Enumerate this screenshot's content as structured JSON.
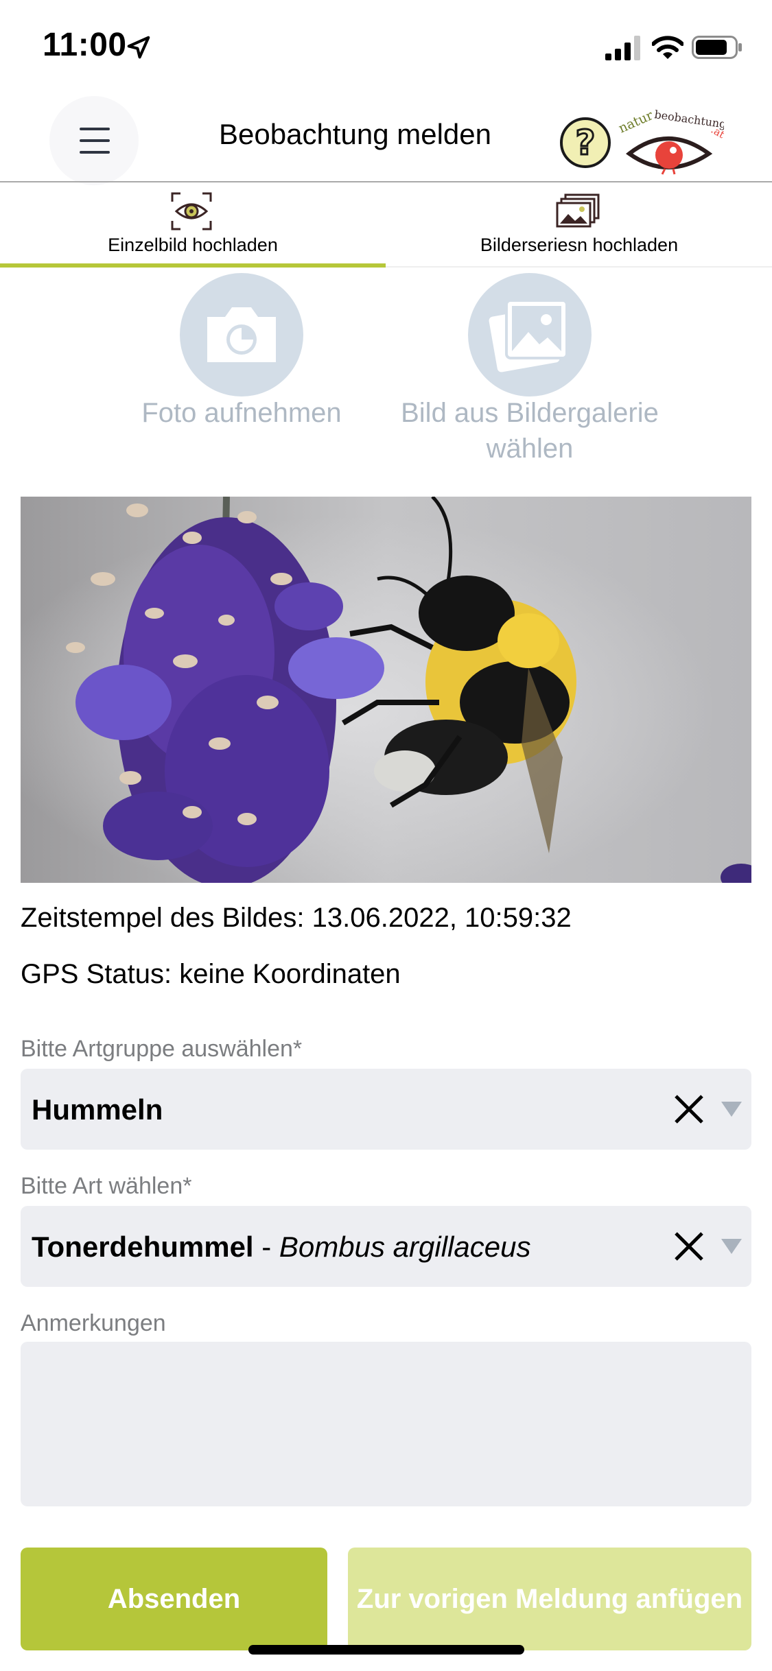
{
  "status_bar": {
    "time": "11:00"
  },
  "header": {
    "title": "Beobachtung melden",
    "logo_text": "naturbeobachtung.at"
  },
  "tabs": [
    {
      "label": "Einzelbild hochladen",
      "icon": "eye-scan-icon",
      "active": true
    },
    {
      "label": "Bilderseriesn hochladen",
      "icon": "photo-stack-icon",
      "active": false
    }
  ],
  "actions": {
    "camera_label": "Foto aufnehmen",
    "gallery_label": "Bild aus Bildergalerie wählen"
  },
  "info": {
    "timestamp": "Zeitstempel des Bildes: 13.06.2022, 10:59:32",
    "gps": "GPS Status: keine Koordinaten"
  },
  "form": {
    "group_label": "Bitte Artgruppe auswählen*",
    "group_value": "Hummeln",
    "species_label": "Bitte Art wählen*",
    "species_common": "Tonerdehummel",
    "species_sep": " - ",
    "species_scientific": "Bombus argillaceus",
    "notes_label": "Anmerkungen",
    "notes_value": ""
  },
  "buttons": {
    "send": "Absenden",
    "attach": "Zur vorigen Meldung anfügen"
  },
  "colors": {
    "accent": "#b5c63a",
    "accent_light": "#dde69a",
    "muted_circle": "#d3dde7"
  }
}
